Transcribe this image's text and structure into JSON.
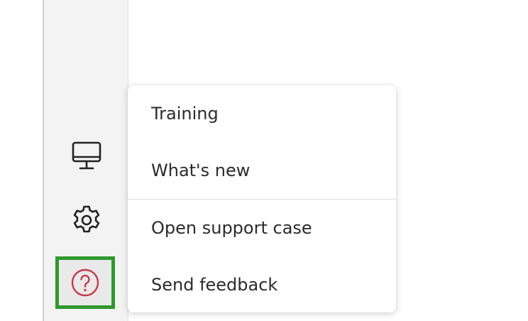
{
  "sidebar": {
    "icons": [
      {
        "name": "monitor-icon"
      },
      {
        "name": "gear-icon"
      },
      {
        "name": "help-icon",
        "highlight_color": "#2e9a2e",
        "icon_color": "#c8384a"
      }
    ]
  },
  "help_menu": {
    "items": [
      {
        "label": "Training"
      },
      {
        "label": "What's new"
      },
      {
        "label": "Open support case"
      },
      {
        "label": "Send feedback"
      }
    ]
  }
}
